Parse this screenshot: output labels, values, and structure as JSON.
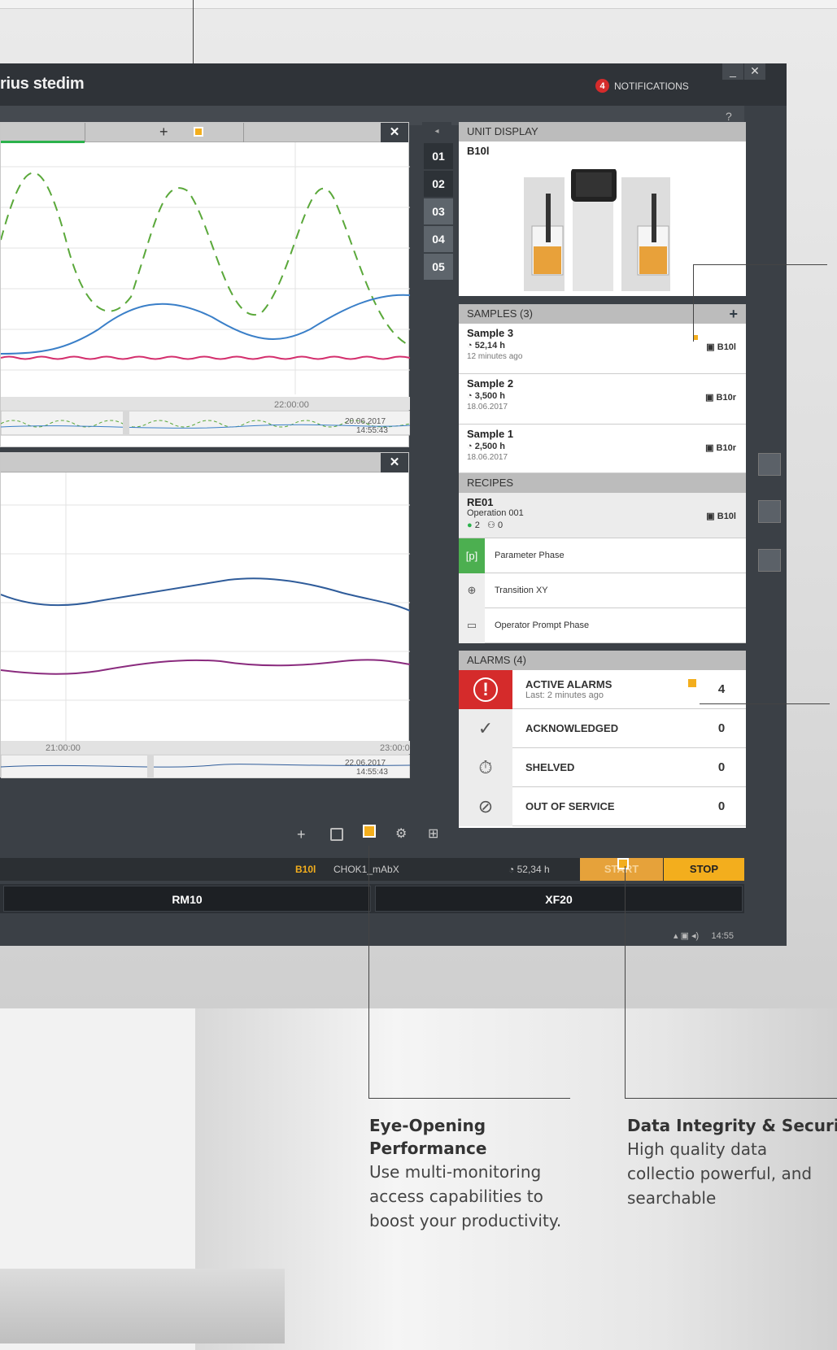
{
  "app": {
    "brand": "rius stedim",
    "notifications_count": "4",
    "notifications_label": "NOTIFICATIONS",
    "help": "?",
    "minimize": "_",
    "close": "✕"
  },
  "trend_top": {
    "add_tab": "+",
    "close": "✕",
    "time_label": "22:00:00",
    "range_end_date": "20.06.2017",
    "range_end_time": "14:55:43"
  },
  "trend_tabs": [
    "01",
    "02",
    "03",
    "04",
    "05"
  ],
  "trend_bottom": {
    "close": "✕",
    "time_label_1": "21:00:00",
    "time_label_2": "23:00:0",
    "range_end_date": "22.06.2017",
    "range_end_time": "14:55:43"
  },
  "trend_tools": {
    "add": "+"
  },
  "unit_display": {
    "header": "UNIT DISPLAY",
    "unit": "B10l"
  },
  "samples": {
    "header": "SAMPLES (3)",
    "add": "+",
    "items": [
      {
        "name": "Sample 3",
        "duration": "52,14 h",
        "date": "12 minutes ago",
        "device": "B10l"
      },
      {
        "name": "Sample 2",
        "duration": "3,500 h",
        "date": "18.06.2017",
        "device": "B10r"
      },
      {
        "name": "Sample 1",
        "duration": "2,500 h",
        "date": "18.06.2017",
        "device": "B10r"
      }
    ]
  },
  "recipes": {
    "header": "RECIPES",
    "name": "RE01",
    "operation": "Operation 001",
    "count_a": "2",
    "count_b": "0",
    "device": "B10l",
    "steps": [
      {
        "icon": "[p]",
        "label": "Parameter Phase"
      },
      {
        "icon": "⊕",
        "label": "Transition XY"
      },
      {
        "icon": "▭",
        "label": "Operator Prompt Phase"
      }
    ]
  },
  "alarms": {
    "header": "ALARMS (4)",
    "items": [
      {
        "label": "ACTIVE ALARMS",
        "sub": "Last: 2 minutes ago",
        "count": "4",
        "icon": "!"
      },
      {
        "label": "ACKNOWLEDGED",
        "sub": "",
        "count": "0",
        "icon": "✓"
      },
      {
        "label": "SHELVED",
        "sub": "",
        "count": "0",
        "icon": "⏱"
      },
      {
        "label": "OUT OF SERVICE",
        "sub": "",
        "count": "0",
        "icon": "⊘"
      }
    ]
  },
  "status": {
    "unit": "B10l",
    "batch": "CHOK1_mAbX",
    "elapsed": "52,34 h",
    "start": "START",
    "stop": "STOP"
  },
  "units": [
    "RM10",
    "XF20"
  ],
  "taskbar": {
    "clock": "14:55"
  },
  "captions": [
    {
      "title": "Eye-Opening Performance",
      "body": "Use multi-monitoring access capabilities to boost your productivity."
    },
    {
      "title": "Data Integrity & Securit",
      "body": "High quality data collectio powerful, and searchable"
    }
  ],
  "colors": {
    "accent": "#f3ae1d",
    "alarm_red": "#d52b2b",
    "series_green": "#5aa83a",
    "series_blue": "#3a7fc8",
    "series_magenta": "#d4306e",
    "series_purple": "#8a2b7e",
    "series_navy": "#2f5c9a"
  }
}
